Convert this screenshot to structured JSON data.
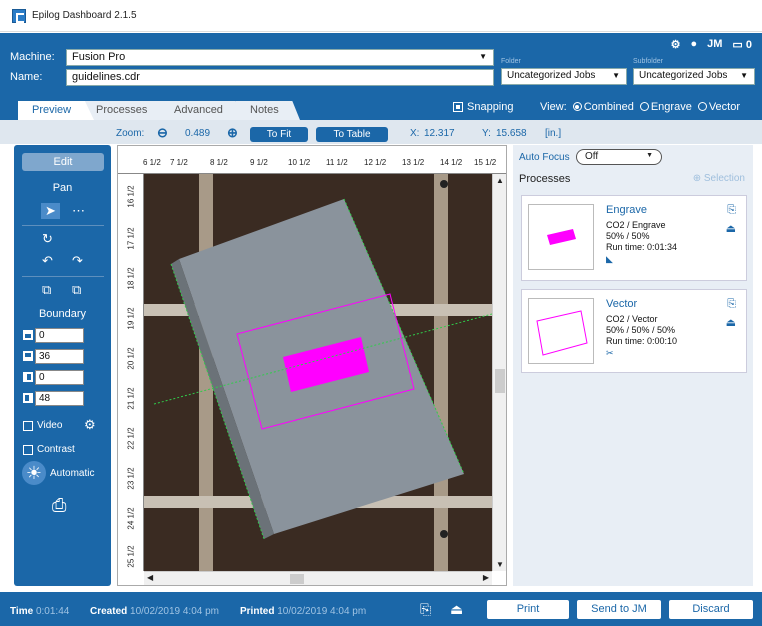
{
  "window": {
    "title": "Epilog Dashboard 2.1.5"
  },
  "header": {
    "machine_label": "Machine:",
    "machine_value": "Fusion Pro",
    "name_label": "Name:",
    "name_value": "guidelines.cdr",
    "folder_label": "Folder",
    "folder_value": "Uncategorized Jobs",
    "subfolder_label": "Subfolder",
    "subfolder_value": "Uncategorized Jobs",
    "user_initials": "JM",
    "queue_count": "0"
  },
  "tabs": [
    {
      "label": "Preview",
      "active": true
    },
    {
      "label": "Processes",
      "active": false
    },
    {
      "label": "Advanced",
      "active": false
    },
    {
      "label": "Notes",
      "active": false
    }
  ],
  "options": {
    "snapping_label": "Snapping",
    "view_label": "View:",
    "view_combined": "Combined",
    "view_engrave": "Engrave",
    "view_vector": "Vector"
  },
  "zoom": {
    "label": "Zoom:",
    "value": "0.489",
    "to_fit": "To Fit",
    "to_table": "To Table",
    "x_label": "X:",
    "x_value": "12.317",
    "y_label": "Y:",
    "y_value": "15.658",
    "unit": "[in.]"
  },
  "left": {
    "edit": "Edit",
    "pan": "Pan",
    "boundary": "Boundary",
    "boundary_values": [
      "0",
      "36",
      "0",
      "48"
    ],
    "video": "Video",
    "contrast": "Contrast",
    "automatic": "Automatic"
  },
  "ruler": {
    "top": [
      "6 1/2",
      "7 1/2",
      "8 1/2",
      "9 1/2",
      "10 1/2",
      "11 1/2",
      "12 1/2",
      "13 1/2",
      "14 1/2",
      "15 1/2"
    ],
    "left": [
      "16 1/2",
      "17 1/2",
      "18 1/2",
      "19 1/2",
      "20 1/2",
      "21 1/2",
      "22 1/2",
      "23 1/2",
      "24 1/2",
      "25 1/2"
    ]
  },
  "right": {
    "auto_focus_label": "Auto Focus",
    "auto_focus_value": "Off",
    "processes_label": "Processes",
    "selection_label": "Selection",
    "processes": [
      {
        "name": "Engrave",
        "line1": "CO2 / Engrave",
        "line2": "50% / 50%",
        "line3": "Run time: 0:01:34"
      },
      {
        "name": "Vector",
        "line1": "CO2 / Vector",
        "line2": "50% / 50% / 50%",
        "line3": "Run time: 0:00:10"
      }
    ]
  },
  "footer": {
    "time_label": "Time",
    "time_value": "0:01:44",
    "created_label": "Created",
    "created_value": "10/02/2019 4:04 pm",
    "printed_label": "Printed",
    "printed_value": "10/02/2019 4:04 pm",
    "print": "Print",
    "send": "Send to JM",
    "discard": "Discard"
  },
  "colors": {
    "brand_blue": "#1b67a8",
    "magenta": "#ff00ff"
  }
}
